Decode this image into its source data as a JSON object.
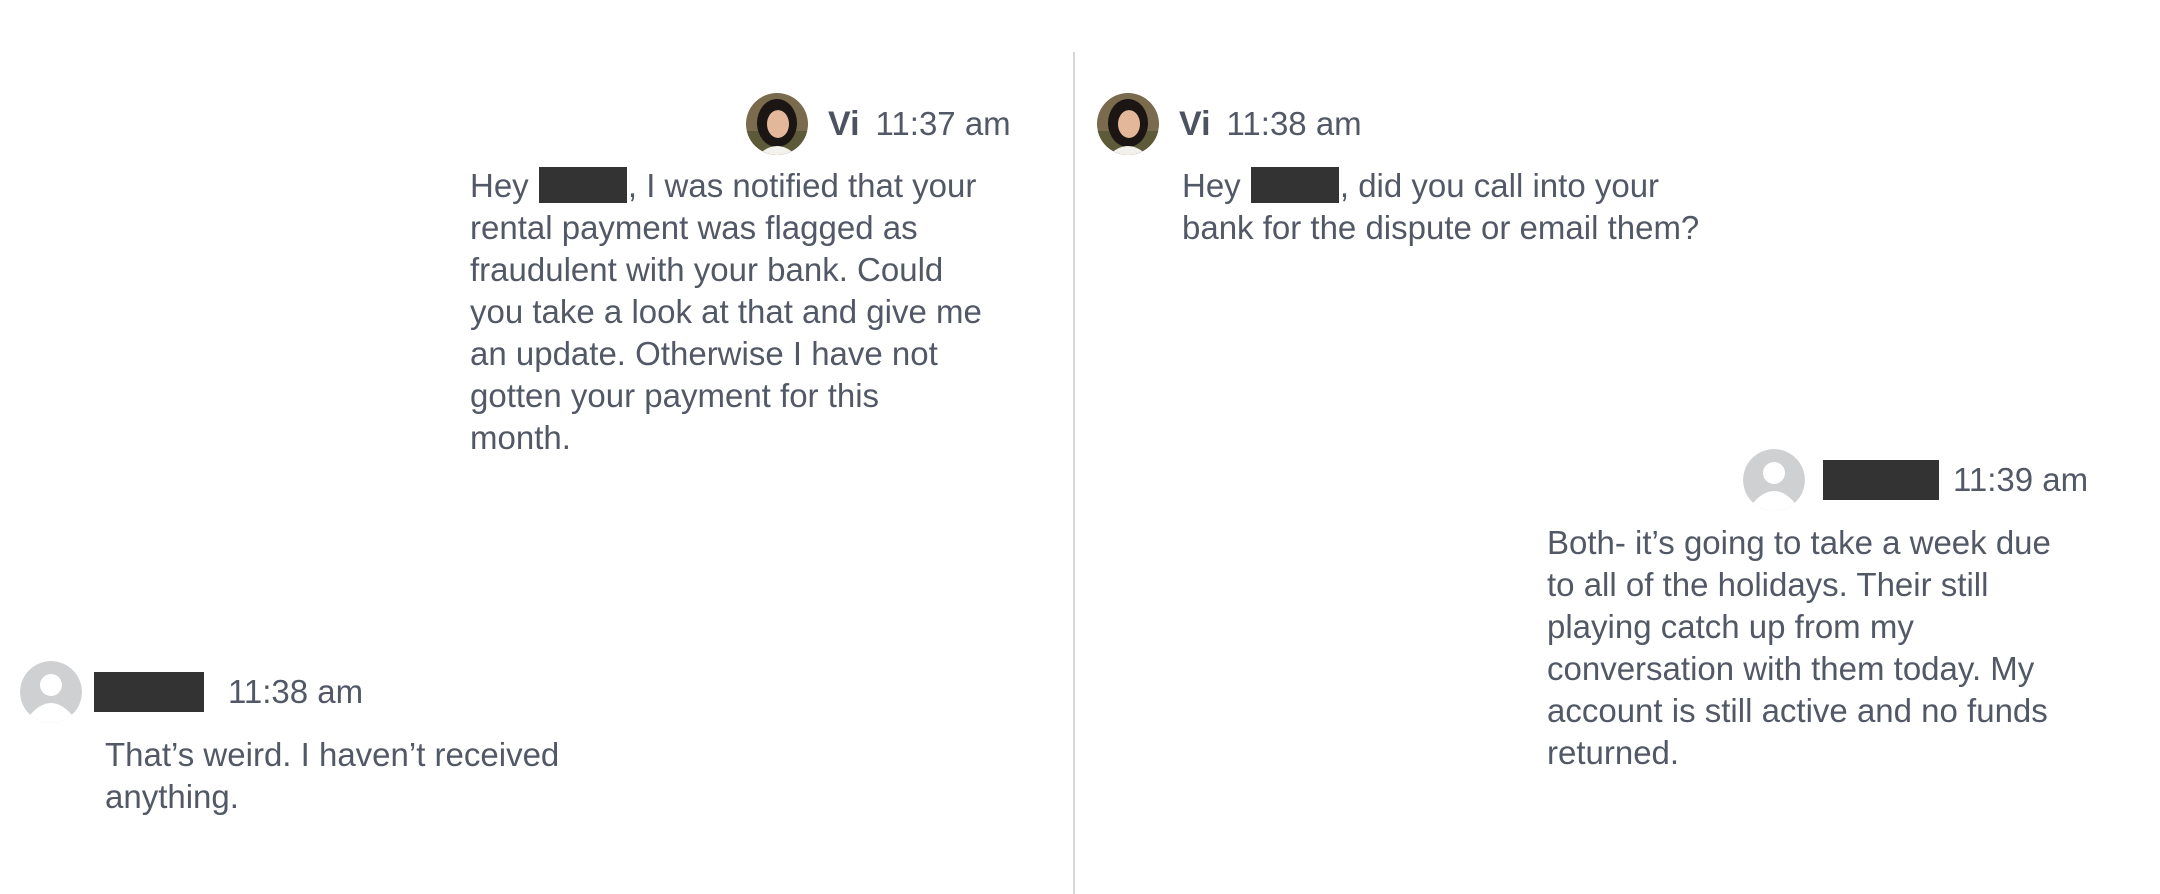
{
  "messages": [
    {
      "sender": "Vi",
      "time": "11:37 am",
      "avatar": "vi-photo-avatar",
      "text_before": "Hey ",
      "text_after": ", I was notified that your",
      "lines": [
        "rental payment was flagged as",
        "fraudulent with your bank. Could",
        "you take a look at that and give me",
        "an update. Otherwise I have not",
        "gotten your payment for this",
        "month."
      ]
    },
    {
      "sender": "",
      "time": "11:38 am",
      "avatar": "default-user-avatar",
      "lines": [
        "That’s weird. I haven’t received",
        "anything."
      ]
    },
    {
      "sender": "Vi",
      "time": "11:38 am",
      "avatar": "vi-photo-avatar",
      "text_before": "Hey ",
      "text_after": ", did you call into your",
      "lines": [
        "bank for the dispute or email them?"
      ]
    },
    {
      "sender": "",
      "time": "11:39 am",
      "avatar": "default-user-avatar",
      "lines": [
        "Both- it’s going to take a week due",
        "to all of the holidays. Their still",
        "playing catch up from my",
        "conversation with them today. My",
        "account is still active and no funds",
        "returned."
      ]
    }
  ],
  "colors": {
    "text": "#525866",
    "name": "#4c5260",
    "redaction": "#333333",
    "divider": "#d7d8db",
    "default_avatar": "#cfd0d2"
  }
}
